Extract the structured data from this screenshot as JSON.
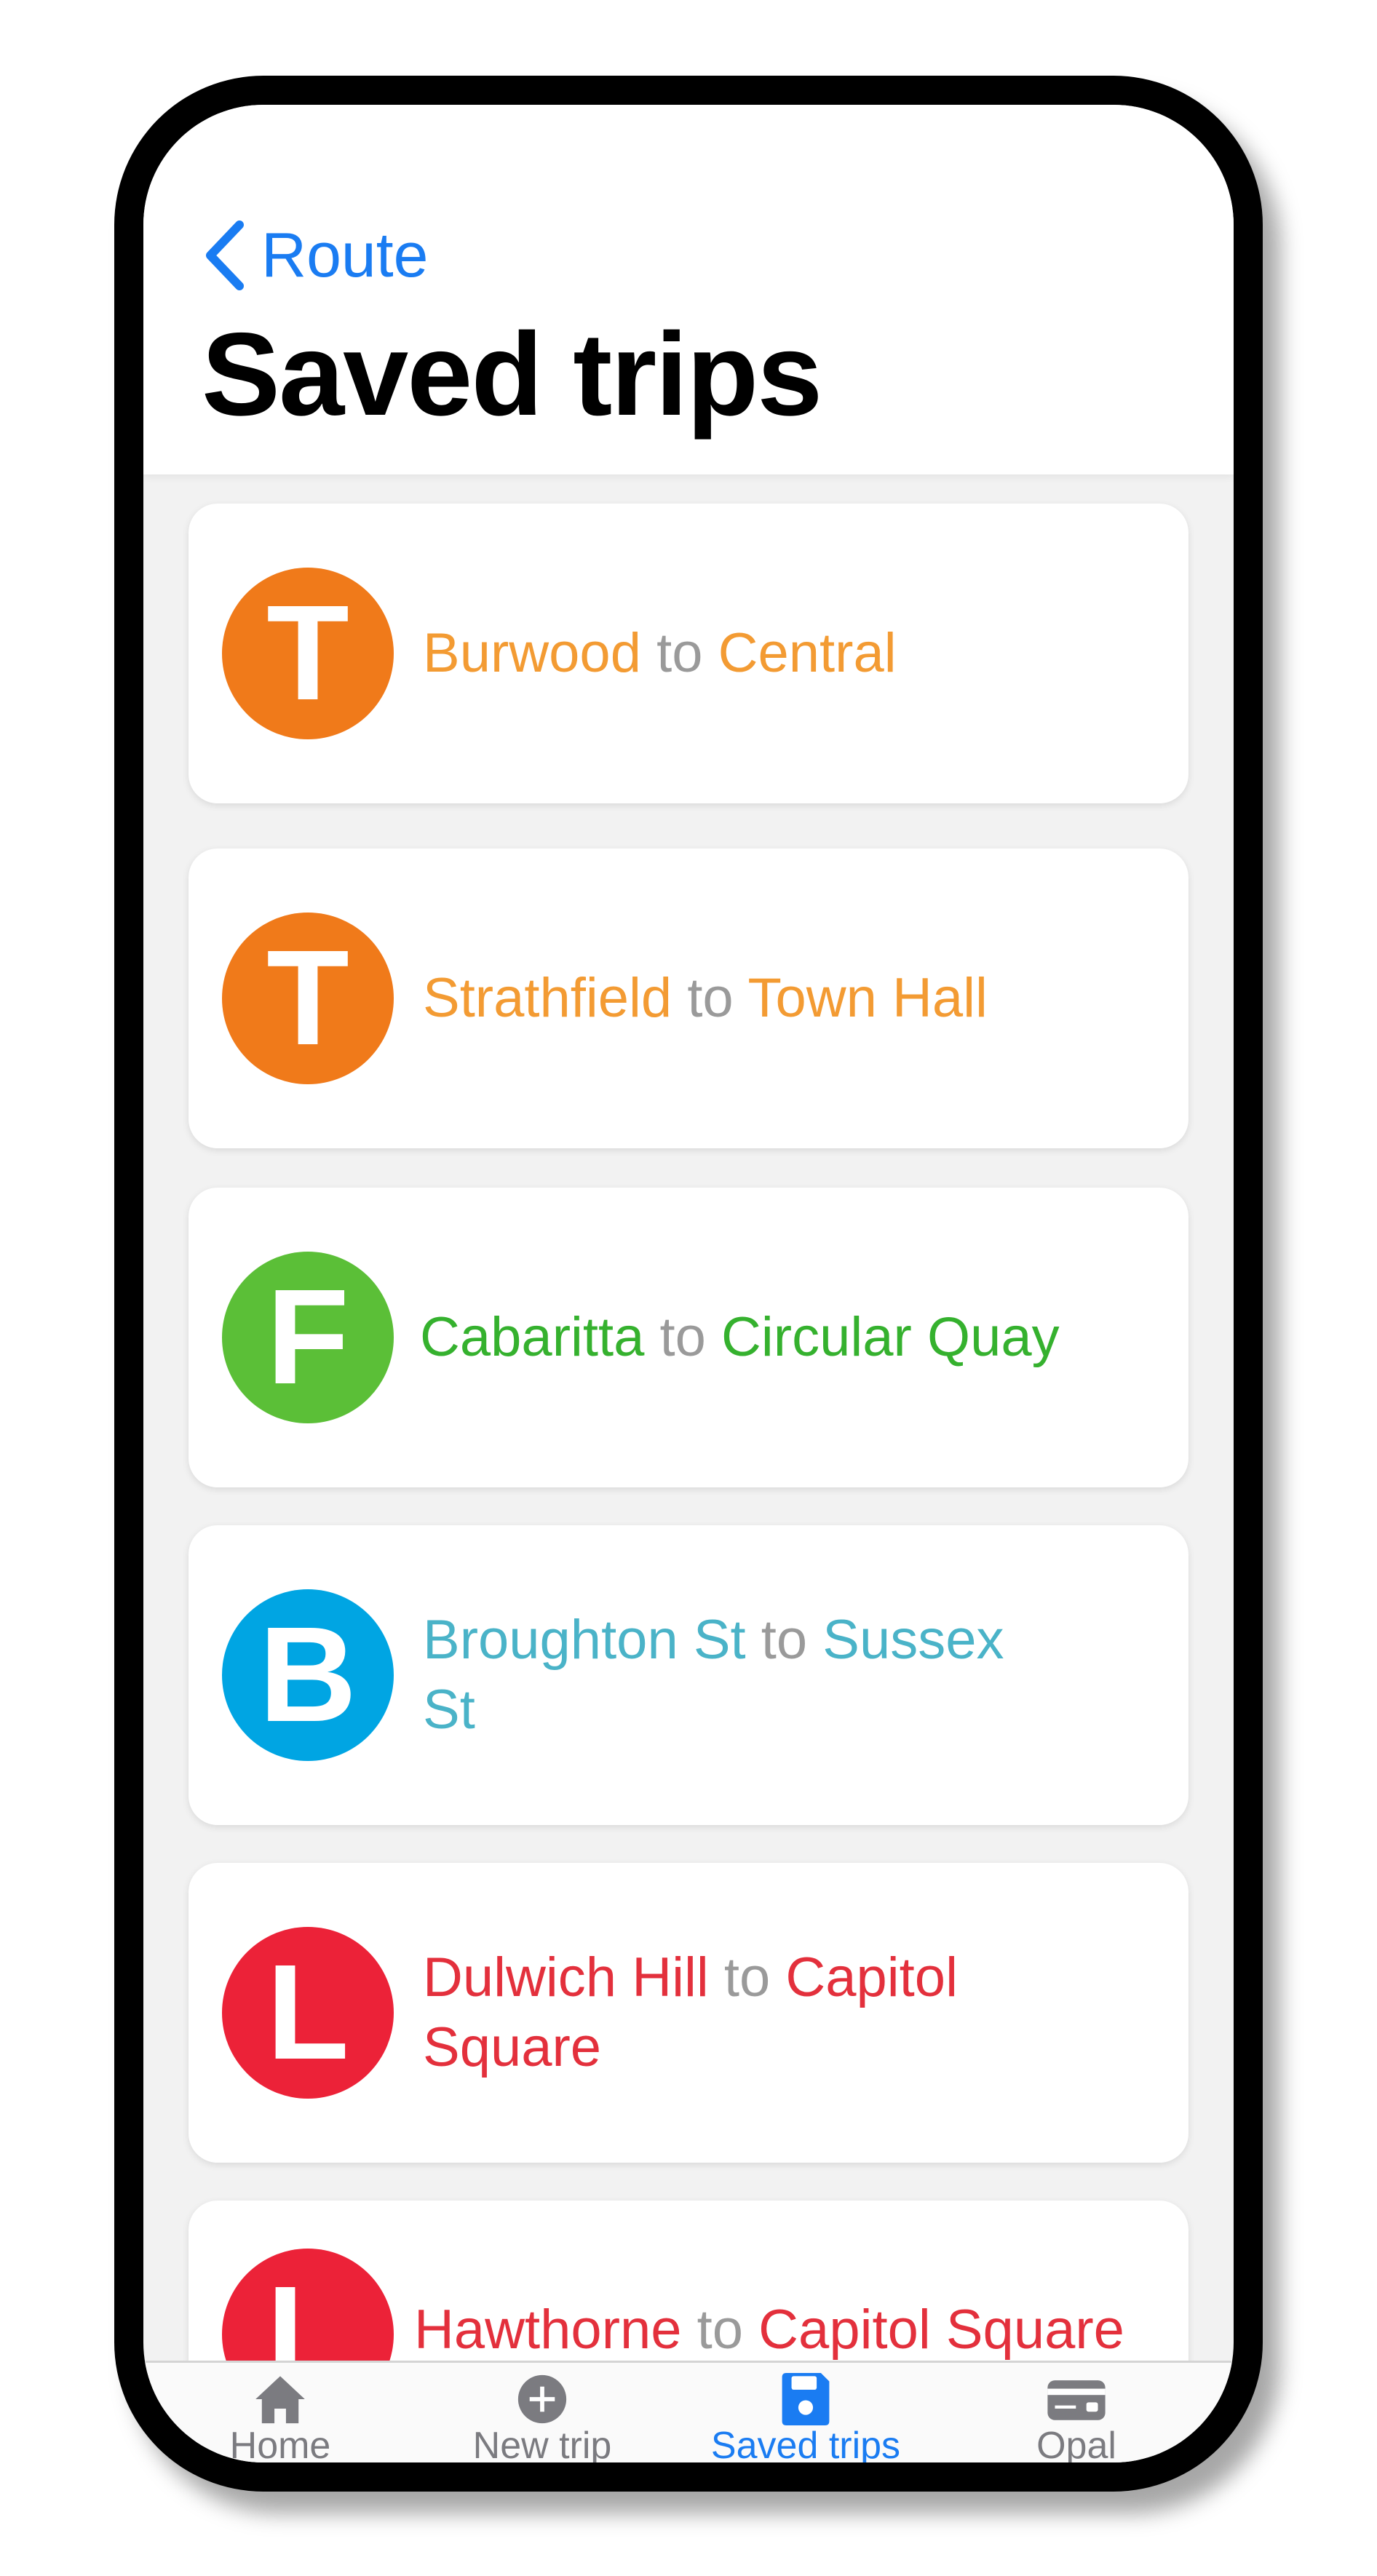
{
  "nav": {
    "back_label": "Route",
    "title": "Saved trips"
  },
  "trips": [
    {
      "mode_letter": "T",
      "mode_color": "#f07a1a",
      "from": "Burwood",
      "sep": "to",
      "to": "Central",
      "text_color": "#f39b33"
    },
    {
      "mode_letter": "T",
      "mode_color": "#f07a1a",
      "from": "Strathfield",
      "sep": "to",
      "to": "Town Hall",
      "text_color": "#f39b33"
    },
    {
      "mode_letter": "F",
      "mode_color": "#5bbf37",
      "from": "Cabaritta",
      "sep": "to",
      "to": "Circular Quay",
      "text_color": "#35b12e"
    },
    {
      "mode_letter": "B",
      "mode_color": "#00a5e3",
      "from": "Broughton St",
      "sep": "to",
      "to": "Sussex St",
      "text_color": "#4ab3c8"
    },
    {
      "mode_letter": "L",
      "mode_color": "#ec2238",
      "from": "Dulwich Hill",
      "sep": "to",
      "to": "Capitol Square",
      "text_color": "#e3303c"
    },
    {
      "mode_letter": "L",
      "mode_color": "#ec2238",
      "from": "Hawthorne",
      "sep": "to",
      "to": "Capitol Square",
      "text_color": "#e3303c"
    }
  ],
  "tabbar": {
    "home": "Home",
    "new_trip": "New trip",
    "saved_trips": "Saved trips",
    "opal": "Opal",
    "active_color": "#1a7cf2",
    "inactive_color": "#7b7b80"
  }
}
